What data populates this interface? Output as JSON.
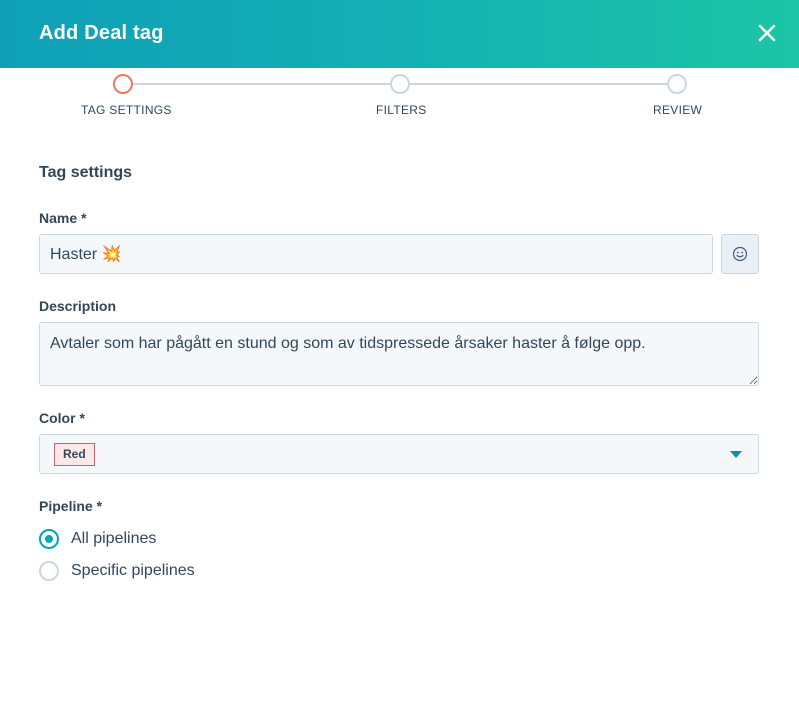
{
  "header": {
    "title": "Add Deal tag",
    "gradient_start": "#0fa0b8",
    "gradient_end": "#1dc5a6",
    "close_icon": "close-icon"
  },
  "stepper": {
    "steps": [
      {
        "label": "TAG SETTINGS",
        "active": true
      },
      {
        "label": "FILTERS",
        "active": false
      },
      {
        "label": "REVIEW",
        "active": false
      }
    ],
    "active_color": "#f2735e",
    "inactive_color": "#cbd6e2"
  },
  "form": {
    "section_title": "Tag settings",
    "name": {
      "label": "Name *",
      "value": "Haster 💥",
      "emoji_button_icon": "smiley-icon"
    },
    "description": {
      "label": "Description",
      "value": "Avtaler som har pågått en stund og som av tidspressede årsaker haster å følge opp."
    },
    "color": {
      "label": "Color *",
      "selected": "Red",
      "badge_bg": "#fde8e9",
      "badge_border": "#f2545b",
      "caret_color": "#0091ae"
    },
    "pipeline": {
      "label": "Pipeline *",
      "options": [
        {
          "label": "All pipelines",
          "checked": true
        },
        {
          "label": "Specific pipelines",
          "checked": false
        }
      ],
      "checked_color": "#00a4bd"
    }
  }
}
